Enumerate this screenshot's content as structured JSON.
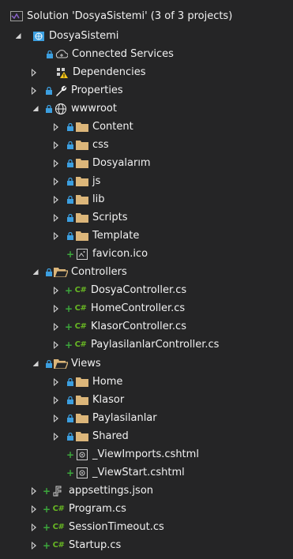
{
  "solution_label": "Solution 'DosyaSistemi' (3 of 3 projects)",
  "project_label": "DosyaSistemi",
  "items": {
    "connected_services": "Connected Services",
    "dependencies": "Dependencies",
    "properties": "Properties",
    "wwwroot": "wwwroot",
    "content": "Content",
    "css": "css",
    "dosyalarim": "Dosyalarım",
    "js": "js",
    "lib": "lib",
    "scripts": "Scripts",
    "template": "Template",
    "favicon": "favicon.ico",
    "controllers": "Controllers",
    "dosya_controller": "DosyaController.cs",
    "home_controller": "HomeController.cs",
    "klasor_controller": "KlasorController.cs",
    "paylasilanlar_controller": "PaylasilanlarController.cs",
    "views": "Views",
    "home": "Home",
    "klasor": "Klasor",
    "paylasilanlar": "Paylasilanlar",
    "shared": "Shared",
    "view_imports": "_ViewImports.cshtml",
    "view_start": "_ViewStart.cshtml",
    "appsettings": "appsettings.json",
    "program": "Program.cs",
    "session_timeout": "SessionTimeout.cs",
    "startup": "Startup.cs"
  },
  "csharp_glyph": "C#",
  "colors": {
    "background": "#252526",
    "text": "#f1f1f1",
    "folder": "#dcb67a",
    "lock": "#3c9fe0",
    "added": "#3ca83c",
    "csharp": "#68b723",
    "solution_icon": "#8661c5",
    "project_icon": "#3c9fe0"
  }
}
